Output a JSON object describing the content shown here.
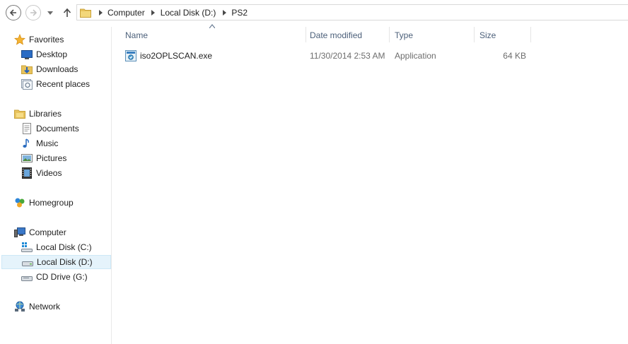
{
  "breadcrumb": [
    "Computer",
    "Local Disk (D:)",
    "PS2"
  ],
  "sidebar": {
    "favorites": {
      "label": "Favorites",
      "items": [
        {
          "label": "Desktop",
          "icon": "desktop-icon"
        },
        {
          "label": "Downloads",
          "icon": "downloads-icon"
        },
        {
          "label": "Recent places",
          "icon": "recent-places-icon"
        }
      ]
    },
    "libraries": {
      "label": "Libraries",
      "items": [
        {
          "label": "Documents",
          "icon": "documents-icon"
        },
        {
          "label": "Music",
          "icon": "music-icon"
        },
        {
          "label": "Pictures",
          "icon": "pictures-icon"
        },
        {
          "label": "Videos",
          "icon": "videos-icon"
        }
      ]
    },
    "homegroup": {
      "label": "Homegroup"
    },
    "computer": {
      "label": "Computer",
      "items": [
        {
          "label": "Local Disk (C:)",
          "icon": "drive-c-icon"
        },
        {
          "label": "Local Disk (D:)",
          "icon": "drive-d-icon",
          "selected": true
        },
        {
          "label": "CD Drive (G:)",
          "icon": "cd-drive-icon"
        }
      ]
    },
    "network": {
      "label": "Network"
    }
  },
  "columns": {
    "name": "Name",
    "date_modified": "Date modified",
    "type": "Type",
    "size": "Size"
  },
  "files": [
    {
      "name": "iso2OPLSCAN.exe",
      "date_modified": "11/30/2014 2:53 AM",
      "type": "Application",
      "size": "64 KB",
      "icon": "application-icon"
    }
  ],
  "colors": {
    "selection_bg": "#e5f3fb",
    "selection_border": "#cde8f6",
    "header_text": "#4c607a",
    "secondary_text": "#6d6d6d"
  }
}
